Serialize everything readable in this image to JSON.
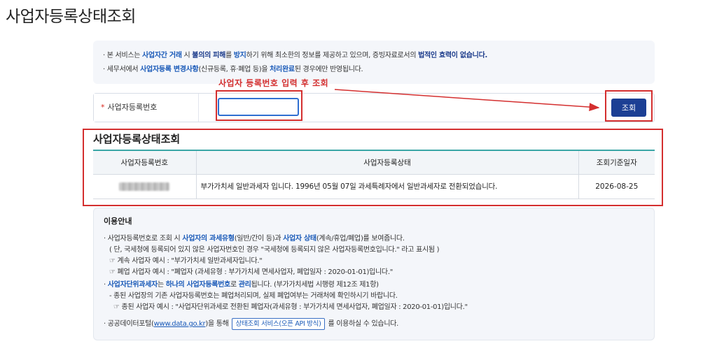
{
  "page": {
    "title": "사업자등록상태조회"
  },
  "notice": {
    "line1": {
      "bullet": "·",
      "t1": " 본 서비스는 ",
      "b1": "사업자간 거래",
      "t2": " 시 ",
      "b2": "불의의 피해",
      "t3": "를 ",
      "b3": "방지",
      "t4": "하기 위해 최소한의 정보를 제공하고 있으며, 증빙자료로서의 ",
      "b4": "법적인 효력이 없습니다."
    },
    "line2": {
      "bullet": "·",
      "t1": " 세무서에서 ",
      "b1": "사업자등록 변경사항",
      "t2": "(신규등록, 휴·폐업 등)을 ",
      "b2": "처리완료",
      "t3": "된 경우에만 반영됩니다."
    }
  },
  "search": {
    "required_mark": "*",
    "label": "사업자등록번호",
    "value": "",
    "button_label": "조회"
  },
  "annotation": {
    "callout": "사업자 등록번호 입력 후 조회",
    "color": "#d42f2f"
  },
  "result": {
    "title": "사업자등록상태조회",
    "columns": [
      "사업자등록번호",
      "사업자등록상태",
      "조회기준일자"
    ],
    "rows": [
      {
        "status": "부가가치세 일반과세자 입니다. 1996년 05월 07일 과세특례자에서 일반과세자로 전환되었습니다.",
        "date": "2026-08-25"
      }
    ]
  },
  "guide": {
    "title": "이용안내",
    "l1": {
      "t1": "· 사업자등록번호로 조회 시 ",
      "b1": "사업자의 과세유형",
      "t2": "(일반/간이 등)과 ",
      "b2": "사업자 상태",
      "t3": "(계속/휴업/폐업)를 보여줍니다."
    },
    "l2": "( 단, 국세청에 등록되어 있지 않은 사업자번호인 경우 \"국세청에 등록되지 않은 사업자등록번호입니다.\" 라고 표시됨 )",
    "l3": "☞ 계속 사업자 예시 : \"부가가치세 일반과세자입니다.\"",
    "l4": "☞ 폐업 사업자 예시 : \"폐업자 (과세유형 : 부가가치세 면세사업자, 폐업일자 : 2020-01-01)입니다.\"",
    "l5": {
      "t0": "· ",
      "b1": "사업자단위과세자",
      "t1": "는 ",
      "b2": "하나의 사업자등록번호",
      "t2": "로 ",
      "b3": "관리",
      "t3": "됩니다. (부가가치세법 시행령 제12조 제1항)"
    },
    "l6": "- 종된 사업장의 기존 사업자등록번호는 폐업처리되며, 실제 폐업여부는 거래처에 확인하시기 바랍니다.",
    "l7": "☞ 종된 사업자 예시 : \"사업자단위과세로 전환된 폐업자(과세유형 : 부가가치세 면세사업자, 폐업일자 : 2020-01-01)입니다.\"",
    "l8": {
      "t1": "· 공공데이터포털(",
      "link": "www.data.go.kr",
      "t2": ")을 통해",
      "button": "상태조회 서비스(오픈 API 방식)",
      "t3": "를 이용하실 수 있습니다."
    }
  }
}
